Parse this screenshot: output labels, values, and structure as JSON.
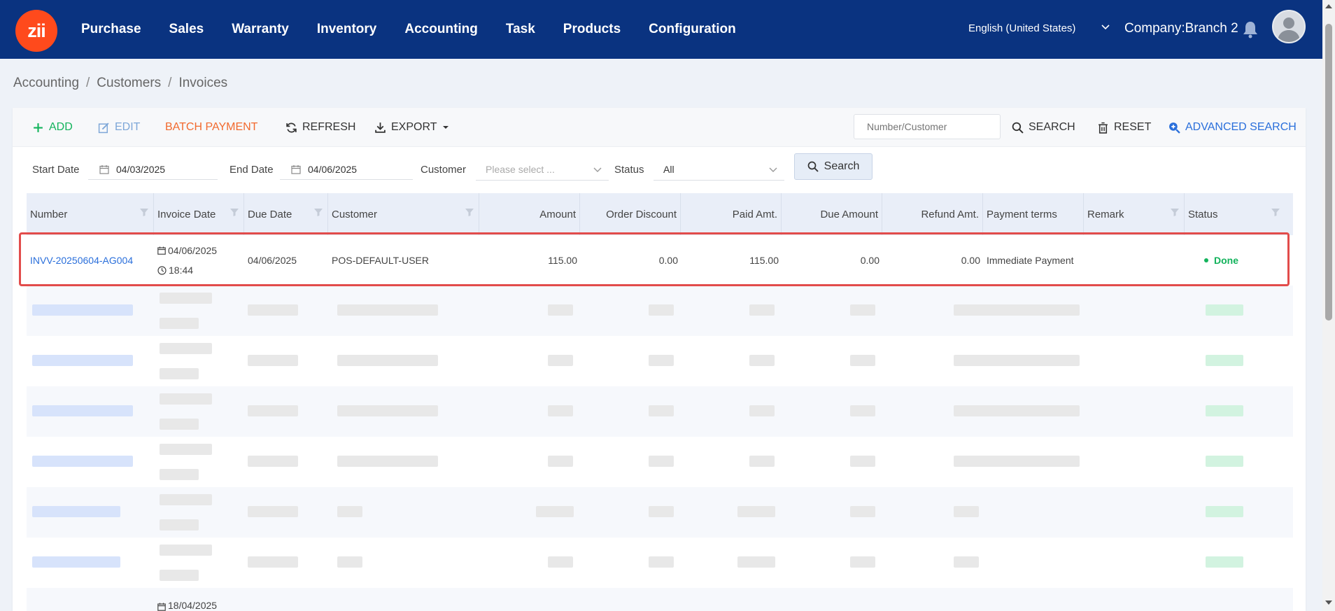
{
  "nav": {
    "logo_text": "zii",
    "items": [
      "Purchase",
      "Sales",
      "Warranty",
      "Inventory",
      "Accounting",
      "Task",
      "Products",
      "Configuration"
    ],
    "language": "English (United States)",
    "company": "Company:Branch 2"
  },
  "breadcrumb": [
    "Accounting",
    "Customers",
    "Invoices"
  ],
  "toolbar": {
    "add": "ADD",
    "edit": "EDIT",
    "batch_payment": "BATCH PAYMENT",
    "refresh": "REFRESH",
    "export": "EXPORT",
    "search_placeholder": "Number/Customer",
    "search": "SEARCH",
    "reset": "RESET",
    "advanced_search": "ADVANCED SEARCH"
  },
  "filters": {
    "start_date_label": "Start Date",
    "start_date": "04/03/2025",
    "end_date_label": "End Date",
    "end_date": "04/06/2025",
    "customer_label": "Customer",
    "customer_placeholder": "Please select ...",
    "status_label": "Status",
    "status_value": "All",
    "search_button": "Search"
  },
  "table": {
    "columns": [
      "Number",
      "Invoice Date",
      "Due Date",
      "Customer",
      "Amount",
      "Order Discount",
      "Paid Amt.",
      "Due Amount",
      "Refund Amt.",
      "Payment terms",
      "Remark",
      "Status"
    ],
    "rows": [
      {
        "number": "INVV-20250604-AG004",
        "invoice_date": "04/06/2025",
        "invoice_time": "18:44",
        "due_date": "04/06/2025",
        "customer": "POS-DEFAULT-USER",
        "amount": "115.00",
        "order_discount": "0.00",
        "paid_amt": "115.00",
        "due_amount": "0.00",
        "refund_amt": "0.00",
        "payment_terms": "Immediate Payment",
        "remark": "",
        "status": "Done"
      }
    ],
    "partial_row_date": "18/04/2025"
  },
  "colors": {
    "topbar": "#0a3380",
    "logo": "#ff4a1c",
    "accent_green": "#13b35c",
    "accent_blue": "#2a6fdb",
    "batch_orange": "#f26a2e",
    "highlight_red": "#e24c4b"
  }
}
